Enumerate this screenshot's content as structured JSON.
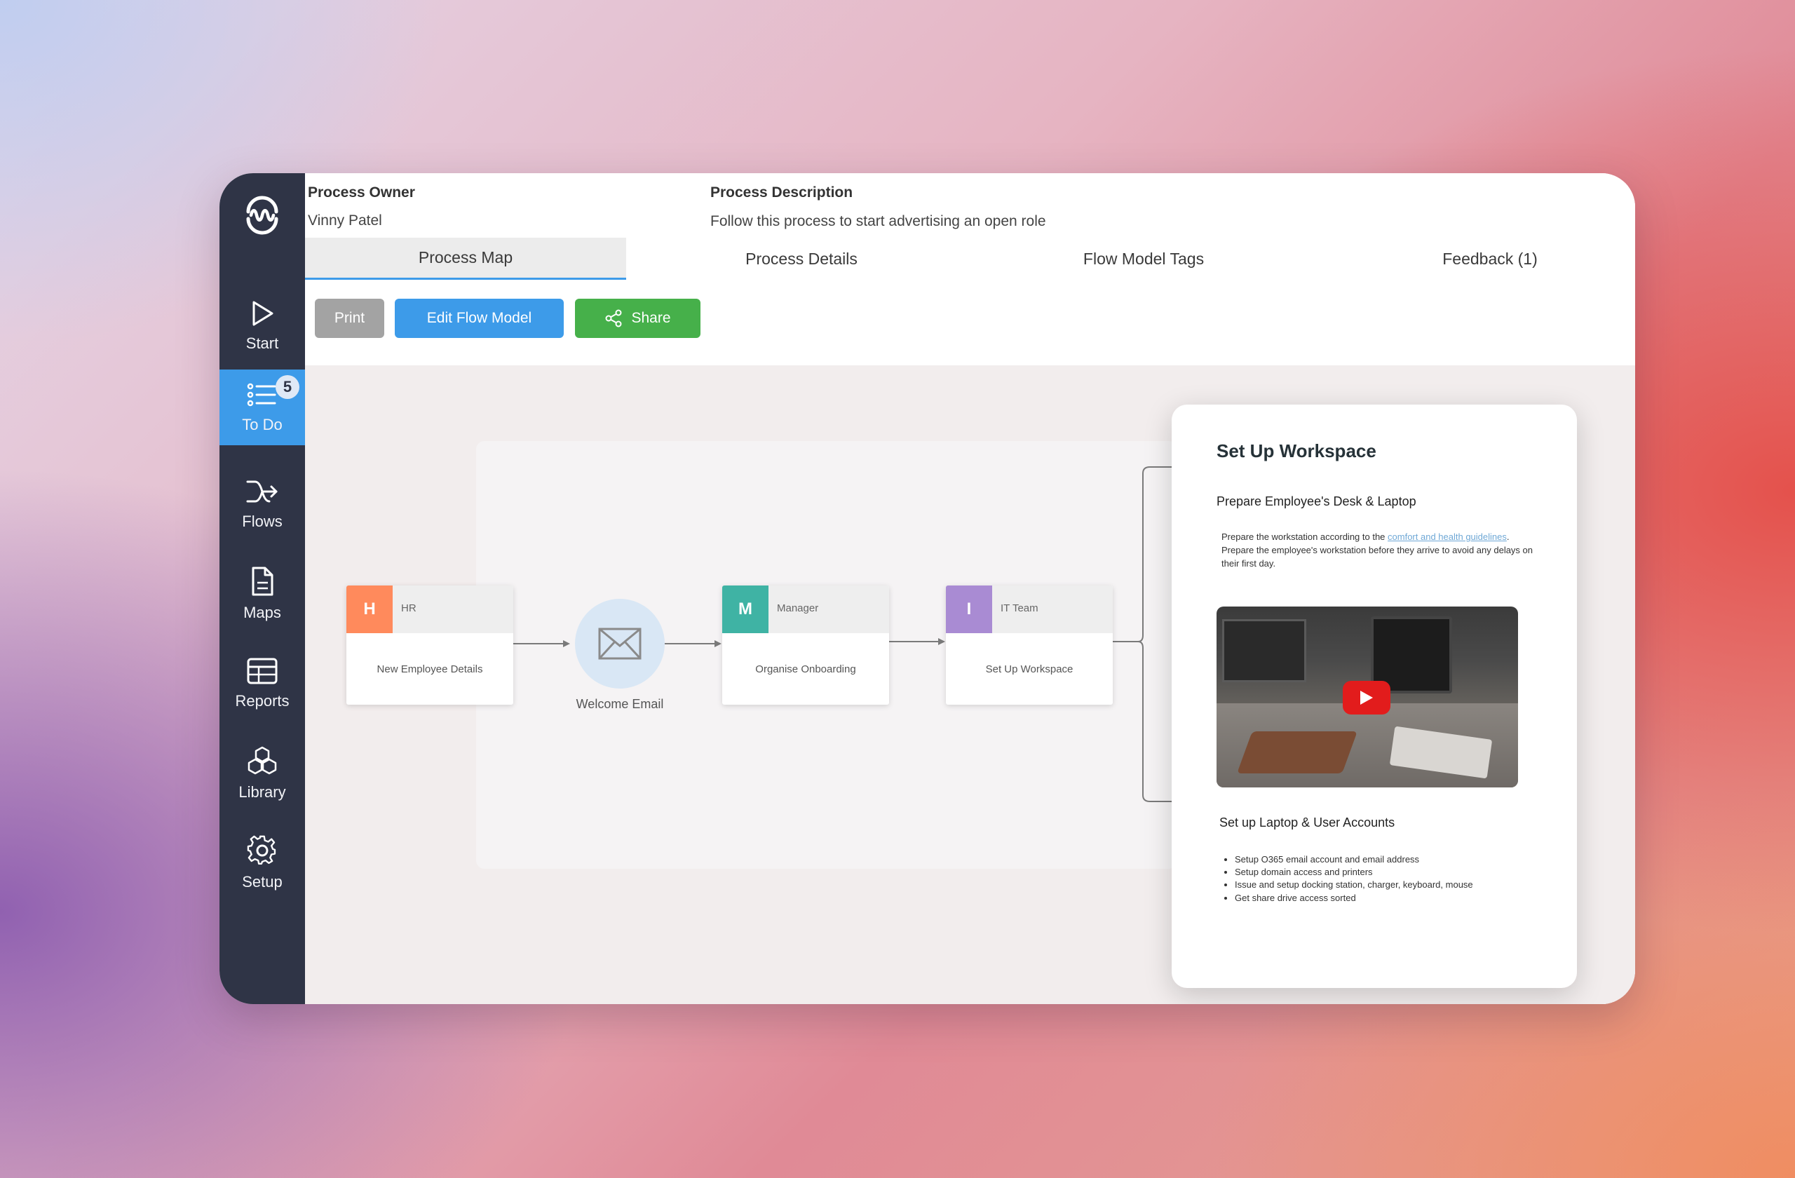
{
  "sidebar": {
    "items": [
      {
        "label": "Start",
        "icon": "play-icon"
      },
      {
        "label": "To Do",
        "icon": "list-icon",
        "badge": "5",
        "active": true
      },
      {
        "label": "Flows",
        "icon": "flow-icon"
      },
      {
        "label": "Maps",
        "icon": "document-icon"
      },
      {
        "label": "Reports",
        "icon": "table-icon"
      },
      {
        "label": "Library",
        "icon": "boxes-icon"
      },
      {
        "label": "Setup",
        "icon": "gear-icon"
      }
    ]
  },
  "header": {
    "owner_label": "Process Owner",
    "owner_value": "Vinny Patel",
    "description_label": "Process Description",
    "description_value": "Follow this process to start advertising an open role"
  },
  "tabs": [
    {
      "label": "Process Map"
    },
    {
      "label": "Process Details"
    },
    {
      "label": "Flow Model Tags"
    },
    {
      "label": "Feedback (1)"
    }
  ],
  "toolbar": {
    "print_label": "Print",
    "edit_label": "Edit Flow Model",
    "share_label": "Share"
  },
  "flow": {
    "nodes": [
      {
        "letter": "H",
        "role": "HR",
        "task": "New Employee Details",
        "color": "#ff8a5c"
      },
      {
        "letter": "M",
        "role": "Manager",
        "task": "Organise Onboarding",
        "color": "#3fb3a4"
      },
      {
        "letter": "I",
        "role": "IT Team",
        "task": "Set Up Workspace",
        "color": "#a98bd3"
      }
    ],
    "email_label": "Welcome Email"
  },
  "card": {
    "title": "Set Up Workspace",
    "section1_title": "Prepare Employee's Desk & Laptop",
    "para_prefix": "Prepare the workstation according to the ",
    "para_link": "comfort and health guidelines",
    "para_suffix": ". Prepare the employee's workstation before they arrive to avoid any delays on their first day.",
    "section2_title": "Set up Laptop & User Accounts",
    "list": [
      "Setup O365 email account and email address",
      "Setup domain access and printers",
      "Issue and setup docking station, charger, keyboard, mouse",
      "Get share drive access sorted"
    ]
  },
  "colors": {
    "sidebar": "#2f3446",
    "accent": "#3d9be9",
    "share": "#46b04a",
    "print": "#a3a3a3"
  }
}
